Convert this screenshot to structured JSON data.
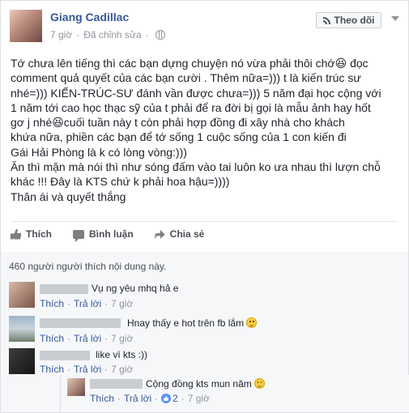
{
  "post": {
    "author": "Giang Cadillac",
    "time": "7 giờ",
    "edited": "Đã chỉnh sửa",
    "follow_label": "Theo dõi",
    "lines": [
      "Tớ chưa lên tiếng thì các bạn dựng chuyện nó vừa phải thôi chớ😆 đọc",
      "comment quả quyết của các bạn cười . Thêm nữa=))) t là kiến trúc sư",
      "nhé=))) KIẾN-TRÚC-SƯ đánh vần được chưa=))) 5 năm đại học cộng với",
      "1 năm tới cao học thạc sỹ của t phải để ra đời bị gọi là mẫu ảnh hay hốt",
      "gơ j nhé😆cuối tuần này t còn phải hợp đồng đi xây nhà cho khách",
      "khứa nữa, phiền các bạn để tớ sống 1 cuộc sống của 1 con kiến đi",
      "Gái Hải Phòng là k có lòng vòng:)))",
      "Ăn thì mặn mà nói thì như sóng đấm vào tai luôn ko ưa nhau thì lượn chỗ",
      "khác !!! Đây là KTS chứ k phải hoa hậu=))))",
      "Thân ái và quyết thắng"
    ]
  },
  "actions": {
    "like": "Thích",
    "comment": "Bình luận",
    "share": "Chia sẻ"
  },
  "likes_text": "460 người người thích nội dung này.",
  "comments": [
    {
      "text": "Vụ ng yêu mhq hả e",
      "like": "Thích",
      "reply": "Trả lời",
      "time": "7 giờ"
    },
    {
      "text": "Hnay thấy e hot trên fb lắm",
      "like": "Thích",
      "reply": "Trả lời",
      "time": "7 giờ"
    },
    {
      "text": "like vì kts :))",
      "like": "Thích",
      "reply": "Trả lời",
      "time": "7 giờ"
    },
    {
      "text": "Cộng đồng kts mun năm",
      "like": "Thích",
      "reply": "Trả lời",
      "likes": "2",
      "time": "7 giờ"
    }
  ],
  "colors": {
    "link": "#365899",
    "meta": "#90949c",
    "panel": "#f6f7f9"
  }
}
